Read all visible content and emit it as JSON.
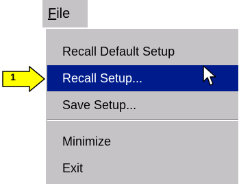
{
  "menubar": {
    "file_mnemonic": "F",
    "file_rest": "ile"
  },
  "menu": {
    "items": [
      {
        "label": "Recall Default Setup",
        "selected": false
      },
      {
        "label": "Recall Setup...",
        "selected": true
      },
      {
        "label": "Save Setup...",
        "selected": false
      },
      {
        "label": "Minimize",
        "selected": false
      },
      {
        "label": "Exit",
        "selected": false
      }
    ]
  },
  "callout": {
    "number": "1",
    "color": "#ffff00"
  },
  "colors": {
    "menu_background": "#c6c3c6",
    "selection_background": "#001c8c"
  },
  "cursor": "arrow-pointer-icon"
}
